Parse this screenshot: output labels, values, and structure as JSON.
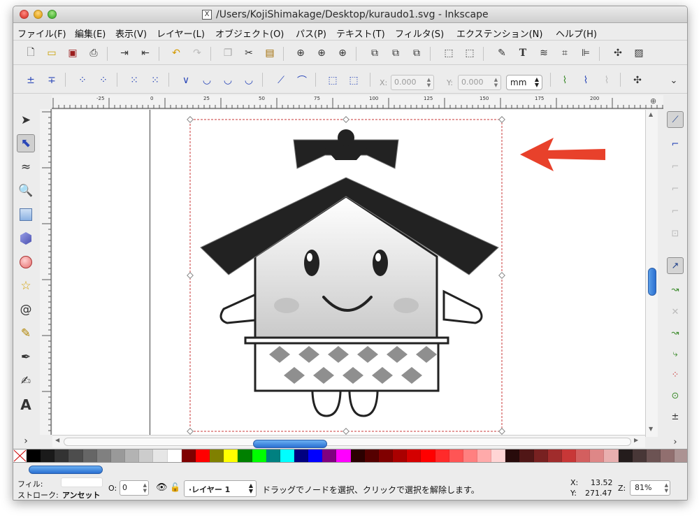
{
  "window": {
    "title": "/Users/KojiShimakage/Desktop/kuraudo1.svg - Inkscape"
  },
  "menu": [
    {
      "label": "ファイル(F)"
    },
    {
      "label": "編集(E)"
    },
    {
      "label": "表示(V)"
    },
    {
      "label": "レイヤー(L)"
    },
    {
      "label": "オブジェクト(O)"
    },
    {
      "label": "パス(P)"
    },
    {
      "label": "テキスト(T)"
    },
    {
      "label": "フィルタ(S)"
    },
    {
      "label": "エクステンション(N)"
    },
    {
      "label": "ヘルプ(H)"
    }
  ],
  "node_toolbar": {
    "x_label": "X:",
    "x_value": "0.000",
    "y_label": "Y:",
    "y_value": "0.000",
    "unit": "mm",
    "more": "⌄"
  },
  "ruler": {
    "top_labels": [
      "-25",
      "0",
      "25",
      "50",
      "75",
      "100",
      "125",
      "150",
      "175",
      "200"
    ]
  },
  "status": {
    "fill_label": "フィル:",
    "stroke_label": "ストローク:",
    "stroke_value": "アンセット",
    "opacity_label": "O:",
    "opacity_value": "0",
    "layer_value": "·レイヤー 1",
    "message": "ドラッグでノードを選択、クリックで選択を解除します。",
    "cursor_x_label": "X:",
    "cursor_x": "13.52",
    "cursor_y_label": "Y:",
    "cursor_y": "271.47",
    "zoom_label": "Z:",
    "zoom_value": "81%"
  },
  "palette_colors": [
    "#000000",
    "#1a1a1a",
    "#333333",
    "#4d4d4d",
    "#666666",
    "#808080",
    "#999999",
    "#b3b3b3",
    "#cccccc",
    "#e6e6e6",
    "#ffffff",
    "#800000",
    "#ff0000",
    "#808000",
    "#ffff00",
    "#008000",
    "#00ff00",
    "#008080",
    "#00ffff",
    "#000080",
    "#0000ff",
    "#800080",
    "#ff00ff",
    "#2b0000",
    "#550000",
    "#800000",
    "#aa0000",
    "#d40000",
    "#ff0000",
    "#ff2a2a",
    "#ff5555",
    "#ff8080",
    "#ffaaaa",
    "#ffd5d5",
    "#280b0b",
    "#501616",
    "#782121",
    "#a02c2c",
    "#c83737",
    "#d35f5f",
    "#de8787",
    "#e9afaf",
    "#241c1c",
    "#483737",
    "#6c5353",
    "#916f6f",
    "#ac9393"
  ],
  "accent_color": "#e8412b",
  "icons": {
    "tools": [
      "select-arrow-icon",
      "node-edit-icon",
      "tweak-icon",
      "zoom-icon",
      "rectangle-icon",
      "box-3d-icon",
      "circle-icon",
      "star-icon",
      "spiral-icon",
      "pencil-icon",
      "pen-icon",
      "calligraphy-icon",
      "text-icon"
    ]
  }
}
